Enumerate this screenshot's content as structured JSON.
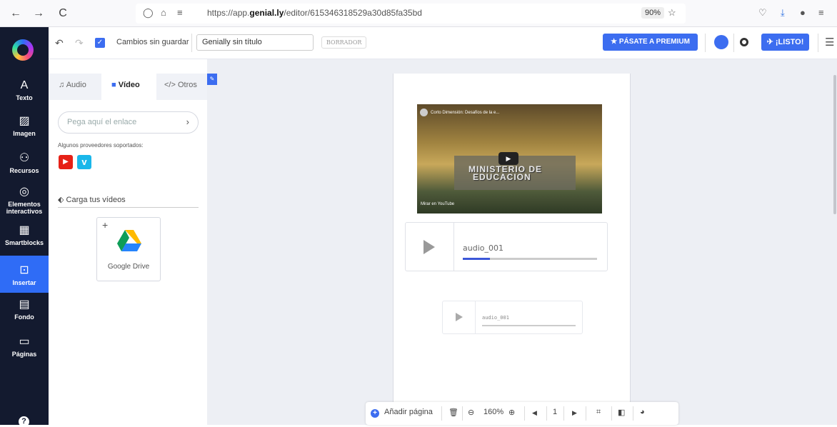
{
  "browser": {
    "back": "←",
    "forward": "→",
    "reload": "C",
    "url_prefix": "https://app.",
    "url_domain": "genial.ly",
    "url_path": "/editor/615346318529a30d85fa35bd",
    "zoom": "90%"
  },
  "leftnav": {
    "items": [
      {
        "icon": "A",
        "label": "Texto"
      },
      {
        "icon": "▨",
        "label": "Imagen"
      },
      {
        "icon": "⚇",
        "label": "Recursos"
      },
      {
        "icon": "◎",
        "label": "Elementos interactivos"
      },
      {
        "icon": "▦",
        "label": "Smartblocks"
      },
      {
        "icon": "⊡",
        "label": "Insertar"
      },
      {
        "icon": "▤",
        "label": "Fondo"
      },
      {
        "icon": "▭",
        "label": "Páginas"
      }
    ],
    "help": "?"
  },
  "topbar": {
    "status": "Cambios sin guardar",
    "title_value": "Genially sin título",
    "draft_badge": "BORRADOR",
    "premium_label": "PÁSATE A PREMIUM",
    "ready_label": "¡LISTO!"
  },
  "panel": {
    "tabs": [
      {
        "icon": "♫",
        "label": "Audio"
      },
      {
        "icon": "■",
        "label": "Vídeo"
      },
      {
        "icon": "</>",
        "label": "Otros"
      }
    ],
    "link_placeholder": "Pega aquí el enlace",
    "providers_label": "Algunos proveedores soportados:",
    "upload_label": "Carga tus vídeos",
    "drive_label": "Google Drive"
  },
  "canvas": {
    "video": {
      "title": "Corto Dimensión: Desafíos de la e...",
      "sign_line1": "MINISTERIO DE",
      "sign_line2": "EDUCACION",
      "watch_on": "Mirar en YouTube"
    },
    "audio_large": {
      "name": "audio_001",
      "progress": 0.2
    },
    "audio_small": {
      "name": "audio_001"
    }
  },
  "bottombar": {
    "add_page": "Añadir página",
    "zoom": "160%",
    "page": "1"
  },
  "colors": {
    "accent": "#3c6df0",
    "nav_bg": "#131a2f"
  }
}
